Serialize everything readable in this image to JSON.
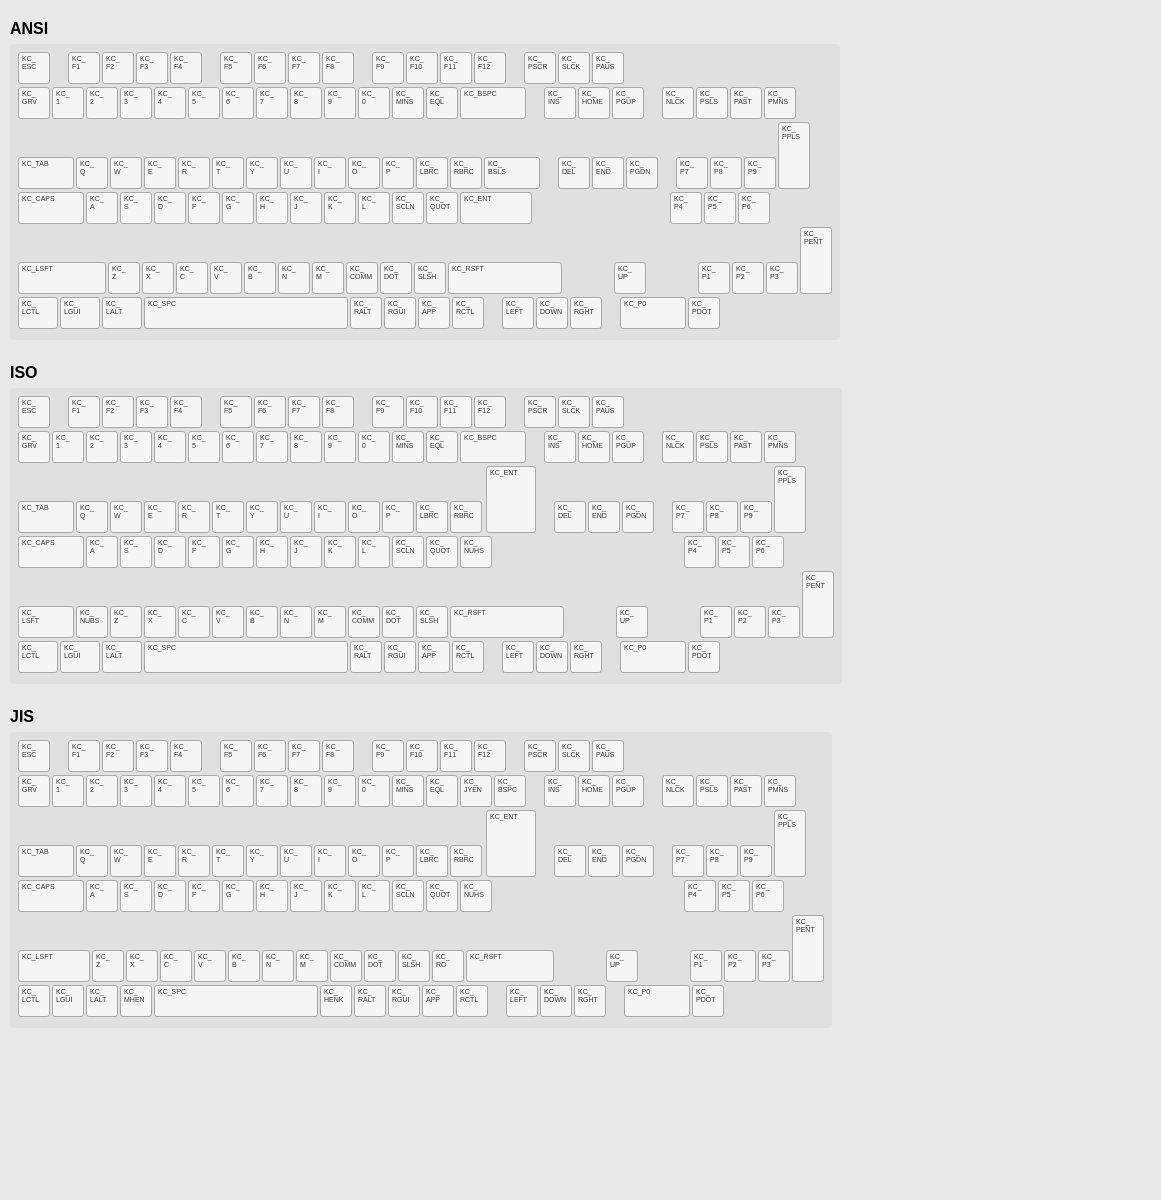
{
  "sections": [
    {
      "title": "ANSI"
    },
    {
      "title": "ISO"
    },
    {
      "title": "JIS"
    }
  ]
}
